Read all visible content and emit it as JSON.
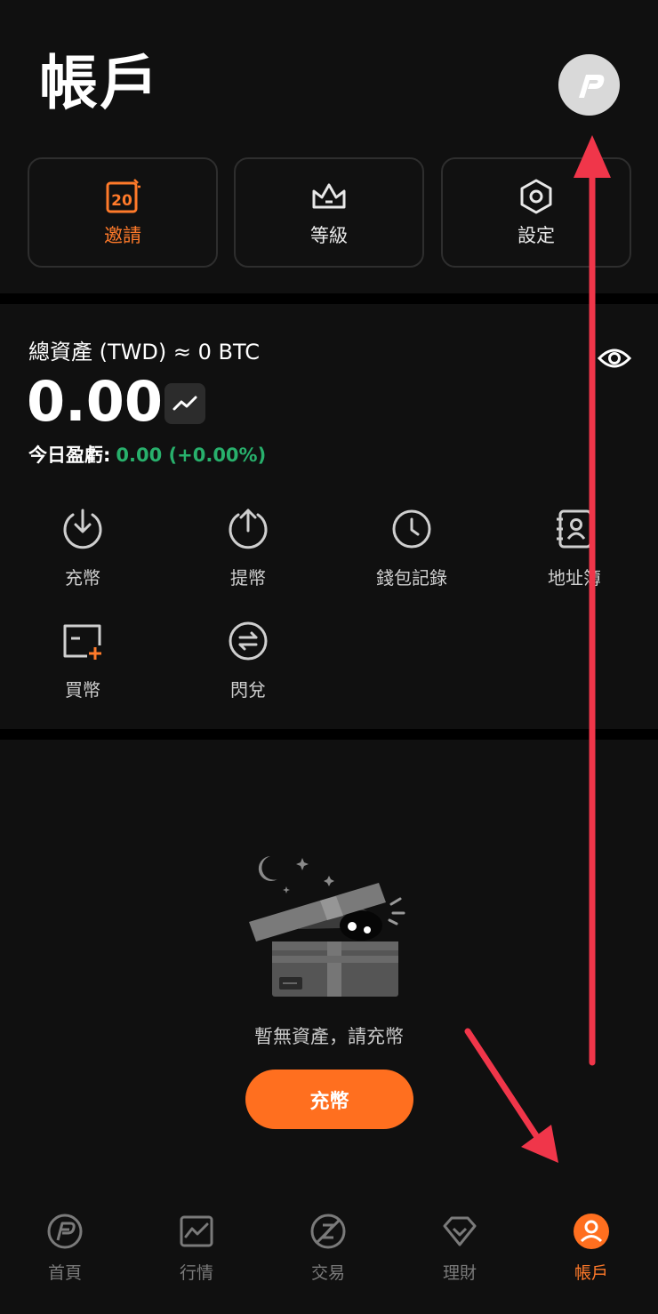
{
  "header": {
    "title": "帳戶",
    "avatar_icon": "p-logo-icon"
  },
  "quick_actions": [
    {
      "label": "邀請",
      "icon": "invite-20-icon",
      "accent": "#ff7a2a"
    },
    {
      "label": "等級",
      "icon": "crown-icon"
    },
    {
      "label": "設定",
      "icon": "hexagon-settings-icon"
    }
  ],
  "assets": {
    "label": "總資產 (TWD) ≈ 0 BTC",
    "balance": "0.00",
    "pnl_label": "今日盈虧:",
    "pnl_value": "0.00 (+0.00%)",
    "pnl_color": "#28b06c"
  },
  "actions": [
    {
      "label": "充幣",
      "icon": "download-circle-icon"
    },
    {
      "label": "提幣",
      "icon": "upload-circle-icon"
    },
    {
      "label": "錢包記錄",
      "icon": "clock-icon"
    },
    {
      "label": "地址簿",
      "icon": "address-book-icon"
    },
    {
      "label": "買幣",
      "icon": "card-plus-icon"
    },
    {
      "label": "閃兌",
      "icon": "swap-icon"
    }
  ],
  "empty_state": {
    "message": "暫無資產，請充幣",
    "button_label": "充幣"
  },
  "bottom_nav": {
    "items": [
      {
        "label": "首頁",
        "icon": "home-logo-icon"
      },
      {
        "label": "行情",
        "icon": "chart-icon"
      },
      {
        "label": "交易",
        "icon": "trade-icon"
      },
      {
        "label": "理財",
        "icon": "diamond-icon"
      },
      {
        "label": "帳戶",
        "icon": "account-icon",
        "active": true
      }
    ]
  },
  "colors": {
    "accent": "#ff6f1f",
    "annotation_arrow": "#f0364a",
    "background": "#101010"
  }
}
